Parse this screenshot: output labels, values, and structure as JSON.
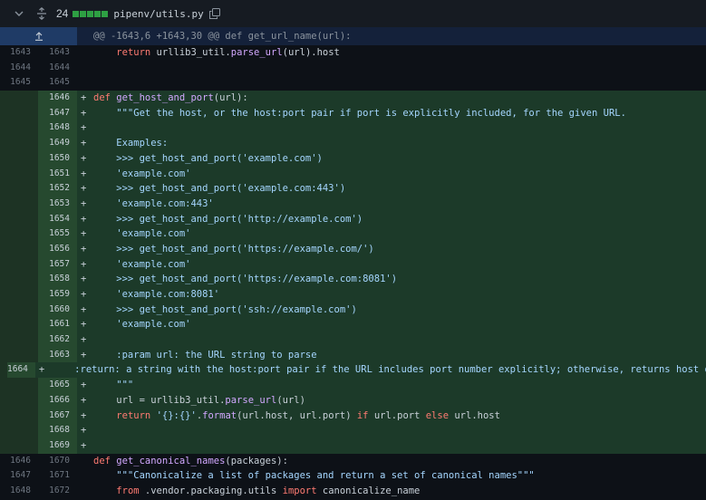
{
  "file": {
    "lines_changed": "24",
    "name": "pipenv/utils.py",
    "icons": [
      "chevron-down-icon",
      "expand-icon",
      "diffstat-icon",
      "copy-icon"
    ]
  },
  "hunk": {
    "text": "@@ -1643,6 +1643,30 @@ def get_url_name(url):",
    "expand_icon": "unfold-up-icon"
  },
  "lines": [
    {
      "type": "ctx",
      "old": "1643",
      "new": "1643",
      "sign": " ",
      "tokens": [
        [
          "p",
          "    "
        ],
        [
          "k",
          "return"
        ],
        [
          "p",
          " urllib3_util."
        ],
        [
          "f",
          "parse_url"
        ],
        [
          "p",
          "(url).host"
        ]
      ]
    },
    {
      "type": "ctx",
      "old": "1644",
      "new": "1644",
      "sign": " ",
      "tokens": []
    },
    {
      "type": "ctx",
      "old": "1645",
      "new": "1645",
      "sign": " ",
      "tokens": []
    },
    {
      "type": "add",
      "old": "",
      "new": "1646",
      "sign": "+",
      "tokens": [
        [
          "k",
          "def"
        ],
        [
          "p",
          " "
        ],
        [
          "f",
          "get_host_and_port"
        ],
        [
          "p",
          "(url):"
        ]
      ]
    },
    {
      "type": "add",
      "old": "",
      "new": "1647",
      "sign": "+",
      "tokens": [
        [
          "s",
          "    \"\"\"Get the host, or the host:port pair if port is explicitly included, for the given URL."
        ]
      ]
    },
    {
      "type": "add",
      "old": "",
      "new": "1648",
      "sign": "+",
      "tokens": []
    },
    {
      "type": "add",
      "old": "",
      "new": "1649",
      "sign": "+",
      "tokens": [
        [
          "s",
          "    Examples:"
        ]
      ]
    },
    {
      "type": "add",
      "old": "",
      "new": "1650",
      "sign": "+",
      "tokens": [
        [
          "s",
          "    >>> get_host_and_port('example.com')"
        ]
      ]
    },
    {
      "type": "add",
      "old": "",
      "new": "1651",
      "sign": "+",
      "tokens": [
        [
          "s",
          "    'example.com'"
        ]
      ]
    },
    {
      "type": "add",
      "old": "",
      "new": "1652",
      "sign": "+",
      "tokens": [
        [
          "s",
          "    >>> get_host_and_port('example.com:443')"
        ]
      ]
    },
    {
      "type": "add",
      "old": "",
      "new": "1653",
      "sign": "+",
      "tokens": [
        [
          "s",
          "    'example.com:443'"
        ]
      ]
    },
    {
      "type": "add",
      "old": "",
      "new": "1654",
      "sign": "+",
      "tokens": [
        [
          "s",
          "    >>> get_host_and_port('http://example.com')"
        ]
      ]
    },
    {
      "type": "add",
      "old": "",
      "new": "1655",
      "sign": "+",
      "tokens": [
        [
          "s",
          "    'example.com'"
        ]
      ]
    },
    {
      "type": "add",
      "old": "",
      "new": "1656",
      "sign": "+",
      "tokens": [
        [
          "s",
          "    >>> get_host_and_port('https://example.com/')"
        ]
      ]
    },
    {
      "type": "add",
      "old": "",
      "new": "1657",
      "sign": "+",
      "tokens": [
        [
          "s",
          "    'example.com'"
        ]
      ]
    },
    {
      "type": "add",
      "old": "",
      "new": "1658",
      "sign": "+",
      "tokens": [
        [
          "s",
          "    >>> get_host_and_port('https://example.com:8081')"
        ]
      ]
    },
    {
      "type": "add",
      "old": "",
      "new": "1659",
      "sign": "+",
      "tokens": [
        [
          "s",
          "    'example.com:8081'"
        ]
      ]
    },
    {
      "type": "add",
      "old": "",
      "new": "1660",
      "sign": "+",
      "tokens": [
        [
          "s",
          "    >>> get_host_and_port('ssh://example.com')"
        ]
      ]
    },
    {
      "type": "add",
      "old": "",
      "new": "1661",
      "sign": "+",
      "tokens": [
        [
          "s",
          "    'example.com'"
        ]
      ]
    },
    {
      "type": "add",
      "old": "",
      "new": "1662",
      "sign": "+",
      "tokens": []
    },
    {
      "type": "add",
      "old": "",
      "new": "1663",
      "sign": "+",
      "tokens": [
        [
          "s",
          "    :param url: the URL string to parse"
        ]
      ]
    },
    {
      "type": "add",
      "old": "",
      "new": "1664",
      "sign": "+",
      "tokens": [
        [
          "s",
          "    :return: a string with the host:port pair if the URL includes port number explicitly; otherwise, returns host only"
        ]
      ]
    },
    {
      "type": "add",
      "old": "",
      "new": "1665",
      "sign": "+",
      "tokens": [
        [
          "s",
          "    \"\"\""
        ]
      ]
    },
    {
      "type": "add",
      "old": "",
      "new": "1666",
      "sign": "+",
      "tokens": [
        [
          "p",
          "    url = urllib3_util."
        ],
        [
          "f",
          "parse_url"
        ],
        [
          "p",
          "(url)"
        ]
      ]
    },
    {
      "type": "add",
      "old": "",
      "new": "1667",
      "sign": "+",
      "tokens": [
        [
          "p",
          "    "
        ],
        [
          "k",
          "return"
        ],
        [
          "p",
          " "
        ],
        [
          "s",
          "'{}:{}'"
        ],
        [
          "p",
          "."
        ],
        [
          "f",
          "format"
        ],
        [
          "p",
          "(url.host, url.port) "
        ],
        [
          "k",
          "if"
        ],
        [
          "p",
          " url.port "
        ],
        [
          "k",
          "else"
        ],
        [
          "p",
          " url.host"
        ]
      ]
    },
    {
      "type": "add",
      "old": "",
      "new": "1668",
      "sign": "+",
      "tokens": []
    },
    {
      "type": "add",
      "old": "",
      "new": "1669",
      "sign": "+",
      "tokens": []
    },
    {
      "type": "ctx",
      "old": "1646",
      "new": "1670",
      "sign": " ",
      "tokens": [
        [
          "k",
          "def"
        ],
        [
          "p",
          " "
        ],
        [
          "f",
          "get_canonical_names"
        ],
        [
          "p",
          "(packages):"
        ]
      ]
    },
    {
      "type": "ctx",
      "old": "1647",
      "new": "1671",
      "sign": " ",
      "tokens": [
        [
          "s",
          "    \"\"\"Canonicalize a list of packages and return a set of canonical names\"\"\""
        ]
      ]
    },
    {
      "type": "ctx",
      "old": "1648",
      "new": "1672",
      "sign": " ",
      "tokens": [
        [
          "p",
          "    "
        ],
        [
          "k",
          "from"
        ],
        [
          "p",
          " .vendor.packaging.utils "
        ],
        [
          "k",
          "import"
        ],
        [
          "p",
          " canonicalize_name"
        ]
      ]
    }
  ]
}
